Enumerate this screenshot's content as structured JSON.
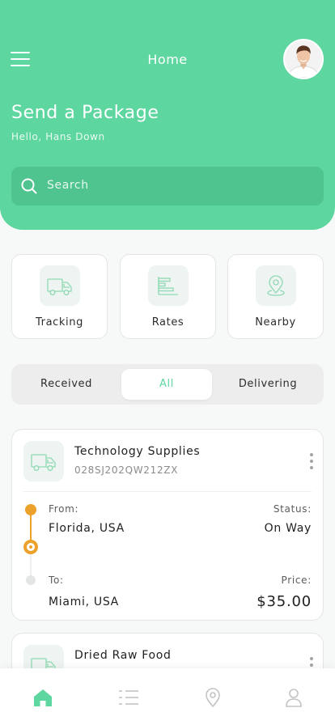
{
  "header": {
    "title": "Home",
    "page_title": "Send a Package",
    "greeting": "Hello, Hans Down",
    "accent_color": "#5ed6a0"
  },
  "search": {
    "placeholder": "Search"
  },
  "services": [
    {
      "label": "Tracking",
      "icon": "truck-icon"
    },
    {
      "label": "Rates",
      "icon": "rates-chart-icon"
    },
    {
      "label": "Nearby",
      "icon": "location-pin-icon"
    }
  ],
  "tabs": [
    {
      "label": "Received"
    },
    {
      "label": "All",
      "active": true
    },
    {
      "label": "Delivering"
    }
  ],
  "shipments": [
    {
      "name": "Technology Supplies",
      "code": "028SJ202QW212ZX",
      "from_label": "From:",
      "from": "Florida, USA",
      "status_label": "Status:",
      "status": "On Way",
      "to_label": "To:",
      "to": "Miami, USA",
      "price_label": "Price:",
      "price": "$35.00",
      "status_color": "#eca12c"
    },
    {
      "name": "Dried Raw Food"
    }
  ],
  "bottom_nav": [
    {
      "icon": "home-icon",
      "active": true
    },
    {
      "icon": "list-icon"
    },
    {
      "icon": "location-pin-icon"
    },
    {
      "icon": "profile-icon"
    }
  ]
}
